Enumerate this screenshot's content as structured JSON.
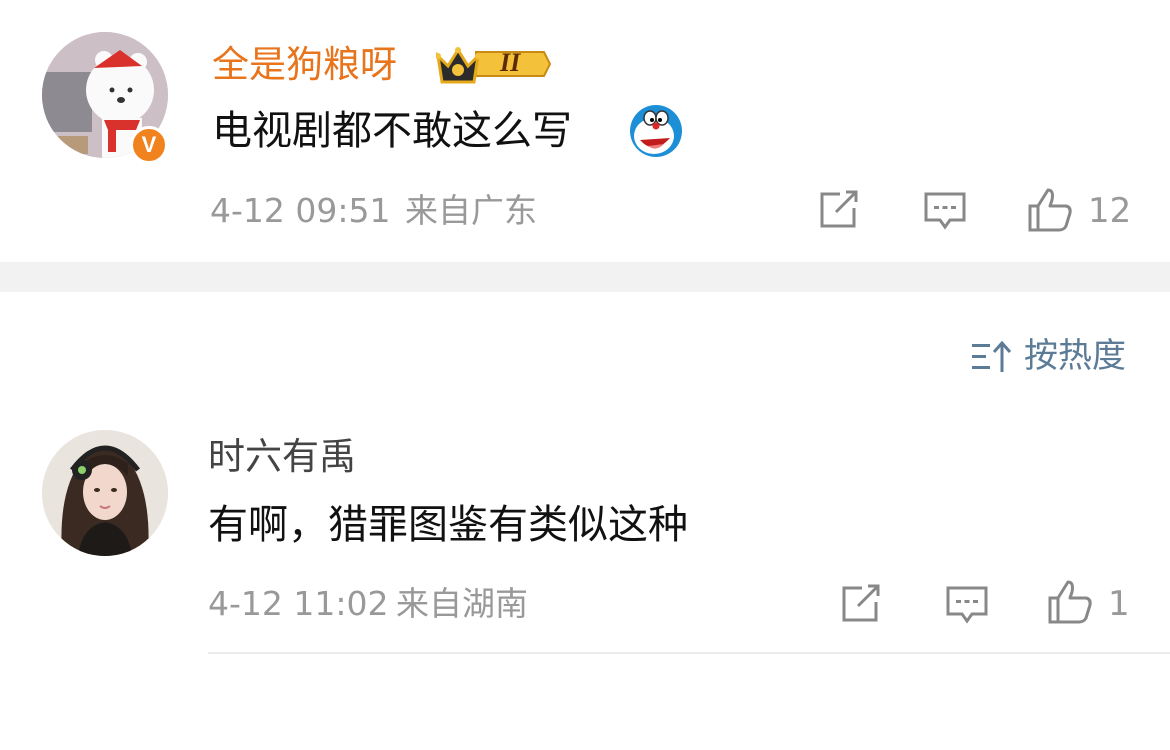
{
  "comments": [
    {
      "username": "全是狗粮呀",
      "badge_level": "II",
      "text": "电视剧都不敢这么写",
      "emoji": "doraemon-emoji",
      "time": "4-12 09:51",
      "location": "来自广东",
      "likes": "12",
      "verified_badge": "V"
    },
    {
      "username": "时六有禹",
      "text": "有啊，猎罪图鉴有类似这种",
      "time": "4-12 11:02",
      "location": "来自湖南",
      "likes": "1"
    }
  ],
  "sort": {
    "label": "按热度"
  },
  "colors": {
    "username_orange": "#e8741c",
    "meta_gray": "#999999",
    "sort_blue": "#5b7b96",
    "verified_orange": "#f0831e"
  }
}
